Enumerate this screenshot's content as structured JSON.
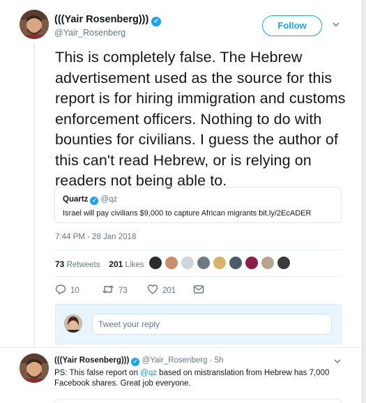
{
  "tweet": {
    "author_name": "(((Yair Rosenberg)))",
    "author_handle": "@Yair_Rosenberg",
    "verified_mark": "✓",
    "follow_label": "Follow",
    "text": "This is completely false. The Hebrew advertisement used as the source for this report is for hiring immigration and customs enforcement officers. Nothing to do with bounties for civilians. I guess the author of this can't read Hebrew, or is relying on readers not being able to.",
    "quoted": {
      "name": "Quartz",
      "handle": "@qz",
      "text": "Israel will pay civilians $9,000 to capture African migrants bit.ly/2EcADER"
    },
    "timestamp": "7:44 PM - 28 Jan 2018",
    "retweets_count": "73",
    "retweets_label": "Retweets",
    "likes_count": "201",
    "likes_label": "Likes",
    "actions": {
      "reply_count": "10",
      "retweet_count": "73",
      "like_count": "201"
    }
  },
  "reply_box": {
    "placeholder": "Tweet your reply"
  },
  "reply_tweet": {
    "author_name": "(((Yair Rosenberg)))",
    "meta": "@Yair_Rosenberg · 5h",
    "text_before": "PS: This false report on ",
    "mention": "@qz",
    "text_after": " based on mistranslation from Hebrew has 7,000 Facebook shares. Great job everyone."
  },
  "icons": [
    "verified-icon",
    "caret-down-icon",
    "reply-icon",
    "retweet-icon",
    "like-icon",
    "direct-message-icon"
  ],
  "colors": {
    "accent": "#1da1f2",
    "text": "#14171a",
    "muted": "#657786",
    "reply_bg": "#e8f5fd"
  }
}
